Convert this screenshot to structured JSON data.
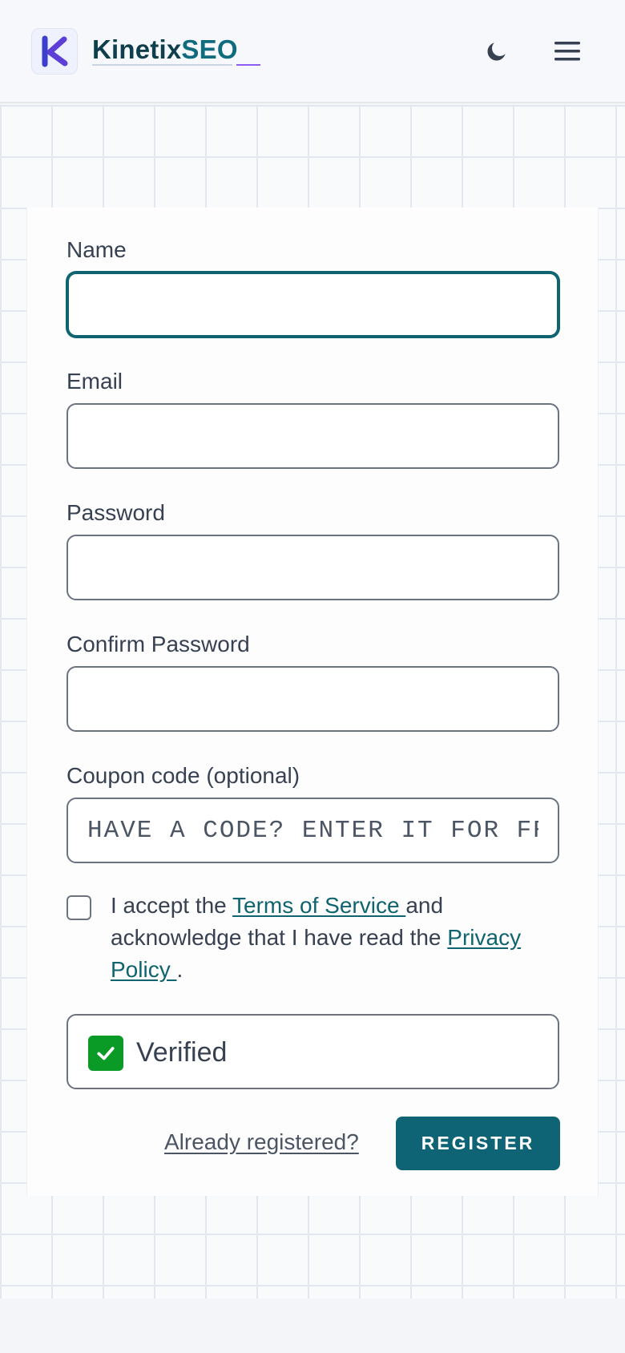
{
  "header": {
    "brand_part1": "Kinetix",
    "brand_part2": "SEO",
    "logo_letter": "K",
    "icons": {
      "theme_toggle": "moon-icon",
      "menu": "hamburger-menu-icon"
    }
  },
  "form": {
    "fields": {
      "name": {
        "label": "Name",
        "value": "",
        "placeholder": ""
      },
      "email": {
        "label": "Email",
        "value": "",
        "placeholder": ""
      },
      "password": {
        "label": "Password",
        "value": "",
        "placeholder": ""
      },
      "confirm_password": {
        "label": "Confirm Password",
        "value": "",
        "placeholder": ""
      },
      "coupon": {
        "label": "Coupon code (optional)",
        "value": "",
        "placeholder": "HAVE A CODE? ENTER IT FOR FREE"
      }
    },
    "terms": {
      "checked": false,
      "prefix": "I accept the ",
      "terms_link": "Terms of Service ",
      "middle": "and acknowledge that I have read the ",
      "privacy_link": "Privacy Policy ",
      "suffix": "."
    },
    "verified": {
      "checked": true,
      "label": "Verified"
    },
    "already_registered_link": "Already registered?",
    "register_button": "REGISTER"
  },
  "colors": {
    "accent": "#0e6474",
    "verified_green": "#0a9a26",
    "logo_purple": "#5b3fd6"
  }
}
